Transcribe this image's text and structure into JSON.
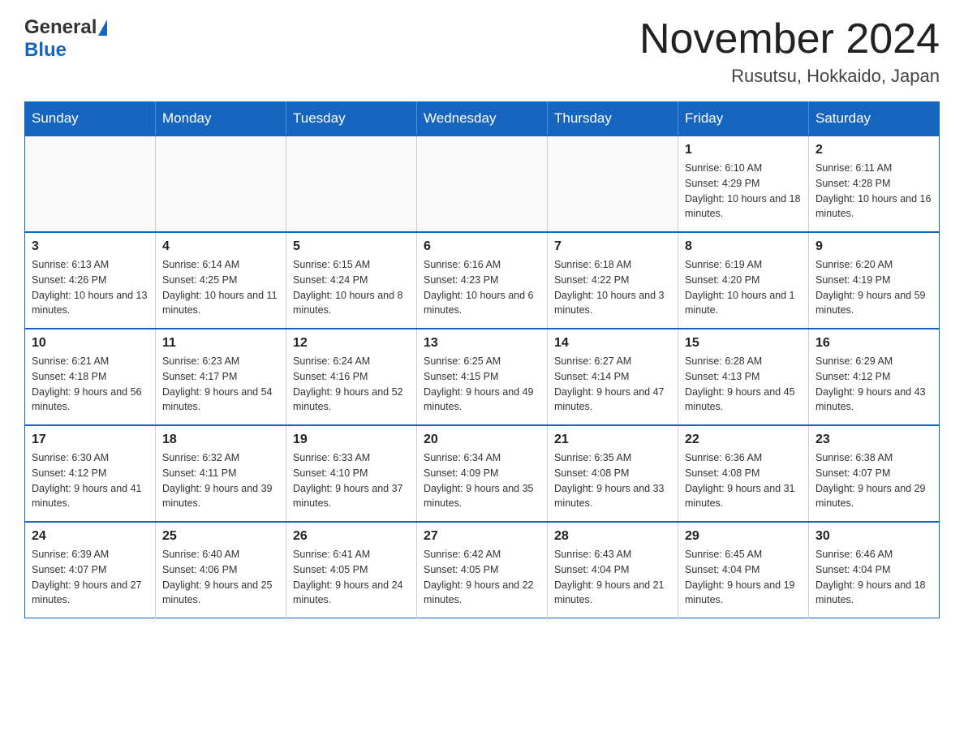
{
  "header": {
    "logo_general": "General",
    "logo_blue": "Blue",
    "title": "November 2024",
    "subtitle": "Rusutsu, Hokkaido, Japan"
  },
  "days_of_week": [
    "Sunday",
    "Monday",
    "Tuesday",
    "Wednesday",
    "Thursday",
    "Friday",
    "Saturday"
  ],
  "weeks": [
    [
      {
        "day": "",
        "info": ""
      },
      {
        "day": "",
        "info": ""
      },
      {
        "day": "",
        "info": ""
      },
      {
        "day": "",
        "info": ""
      },
      {
        "day": "",
        "info": ""
      },
      {
        "day": "1",
        "info": "Sunrise: 6:10 AM\nSunset: 4:29 PM\nDaylight: 10 hours and 18 minutes."
      },
      {
        "day": "2",
        "info": "Sunrise: 6:11 AM\nSunset: 4:28 PM\nDaylight: 10 hours and 16 minutes."
      }
    ],
    [
      {
        "day": "3",
        "info": "Sunrise: 6:13 AM\nSunset: 4:26 PM\nDaylight: 10 hours and 13 minutes."
      },
      {
        "day": "4",
        "info": "Sunrise: 6:14 AM\nSunset: 4:25 PM\nDaylight: 10 hours and 11 minutes."
      },
      {
        "day": "5",
        "info": "Sunrise: 6:15 AM\nSunset: 4:24 PM\nDaylight: 10 hours and 8 minutes."
      },
      {
        "day": "6",
        "info": "Sunrise: 6:16 AM\nSunset: 4:23 PM\nDaylight: 10 hours and 6 minutes."
      },
      {
        "day": "7",
        "info": "Sunrise: 6:18 AM\nSunset: 4:22 PM\nDaylight: 10 hours and 3 minutes."
      },
      {
        "day": "8",
        "info": "Sunrise: 6:19 AM\nSunset: 4:20 PM\nDaylight: 10 hours and 1 minute."
      },
      {
        "day": "9",
        "info": "Sunrise: 6:20 AM\nSunset: 4:19 PM\nDaylight: 9 hours and 59 minutes."
      }
    ],
    [
      {
        "day": "10",
        "info": "Sunrise: 6:21 AM\nSunset: 4:18 PM\nDaylight: 9 hours and 56 minutes."
      },
      {
        "day": "11",
        "info": "Sunrise: 6:23 AM\nSunset: 4:17 PM\nDaylight: 9 hours and 54 minutes."
      },
      {
        "day": "12",
        "info": "Sunrise: 6:24 AM\nSunset: 4:16 PM\nDaylight: 9 hours and 52 minutes."
      },
      {
        "day": "13",
        "info": "Sunrise: 6:25 AM\nSunset: 4:15 PM\nDaylight: 9 hours and 49 minutes."
      },
      {
        "day": "14",
        "info": "Sunrise: 6:27 AM\nSunset: 4:14 PM\nDaylight: 9 hours and 47 minutes."
      },
      {
        "day": "15",
        "info": "Sunrise: 6:28 AM\nSunset: 4:13 PM\nDaylight: 9 hours and 45 minutes."
      },
      {
        "day": "16",
        "info": "Sunrise: 6:29 AM\nSunset: 4:12 PM\nDaylight: 9 hours and 43 minutes."
      }
    ],
    [
      {
        "day": "17",
        "info": "Sunrise: 6:30 AM\nSunset: 4:12 PM\nDaylight: 9 hours and 41 minutes."
      },
      {
        "day": "18",
        "info": "Sunrise: 6:32 AM\nSunset: 4:11 PM\nDaylight: 9 hours and 39 minutes."
      },
      {
        "day": "19",
        "info": "Sunrise: 6:33 AM\nSunset: 4:10 PM\nDaylight: 9 hours and 37 minutes."
      },
      {
        "day": "20",
        "info": "Sunrise: 6:34 AM\nSunset: 4:09 PM\nDaylight: 9 hours and 35 minutes."
      },
      {
        "day": "21",
        "info": "Sunrise: 6:35 AM\nSunset: 4:08 PM\nDaylight: 9 hours and 33 minutes."
      },
      {
        "day": "22",
        "info": "Sunrise: 6:36 AM\nSunset: 4:08 PM\nDaylight: 9 hours and 31 minutes."
      },
      {
        "day": "23",
        "info": "Sunrise: 6:38 AM\nSunset: 4:07 PM\nDaylight: 9 hours and 29 minutes."
      }
    ],
    [
      {
        "day": "24",
        "info": "Sunrise: 6:39 AM\nSunset: 4:07 PM\nDaylight: 9 hours and 27 minutes."
      },
      {
        "day": "25",
        "info": "Sunrise: 6:40 AM\nSunset: 4:06 PM\nDaylight: 9 hours and 25 minutes."
      },
      {
        "day": "26",
        "info": "Sunrise: 6:41 AM\nSunset: 4:05 PM\nDaylight: 9 hours and 24 minutes."
      },
      {
        "day": "27",
        "info": "Sunrise: 6:42 AM\nSunset: 4:05 PM\nDaylight: 9 hours and 22 minutes."
      },
      {
        "day": "28",
        "info": "Sunrise: 6:43 AM\nSunset: 4:04 PM\nDaylight: 9 hours and 21 minutes."
      },
      {
        "day": "29",
        "info": "Sunrise: 6:45 AM\nSunset: 4:04 PM\nDaylight: 9 hours and 19 minutes."
      },
      {
        "day": "30",
        "info": "Sunrise: 6:46 AM\nSunset: 4:04 PM\nDaylight: 9 hours and 18 minutes."
      }
    ]
  ]
}
